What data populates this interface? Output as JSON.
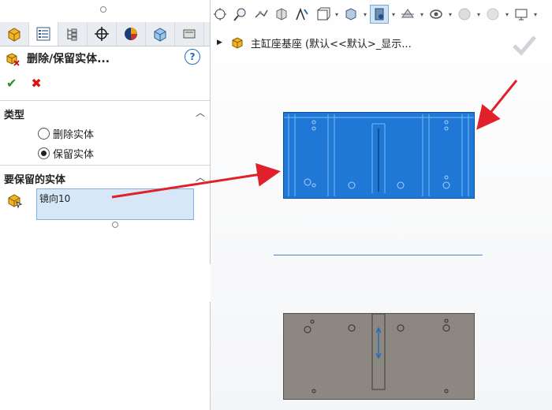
{
  "panel": {
    "title": "删除/保留实体...",
    "help_label": "?",
    "ok_glyph": "✔",
    "cancel_glyph": "✖",
    "type_group": {
      "title": "类型",
      "options": [
        {
          "label": "删除实体",
          "selected": false
        },
        {
          "label": "保留实体",
          "selected": true
        }
      ]
    },
    "keep_group": {
      "title": "要保留的实体",
      "items": [
        "镜向10"
      ]
    }
  },
  "tree": {
    "label": "主缸座基座 (默认<<默认>_显示..."
  },
  "colors": {
    "selected_body": "#1f78d6",
    "body": "#8c8781",
    "arrow": "#e0202a",
    "accent": "#2a6bb8"
  },
  "icons": {
    "tabs": [
      "feature-manager-icon",
      "property-manager-icon",
      "configuration-manager-icon",
      "dimxpert-icon",
      "display-manager-icon",
      "cam-icon",
      "more-tabs-icon"
    ],
    "toolbar": [
      "zoom-to-fit-icon",
      "zoom-area-icon",
      "previous-view-icon",
      "section-view-icon",
      "dynamic-annotation-icon",
      "view-orientation-icon",
      "display-style-icon",
      "hide-show-items-icon",
      "edit-appearance-icon",
      "apply-scene-icon",
      "view-settings-icon",
      "monitor-icon"
    ]
  }
}
